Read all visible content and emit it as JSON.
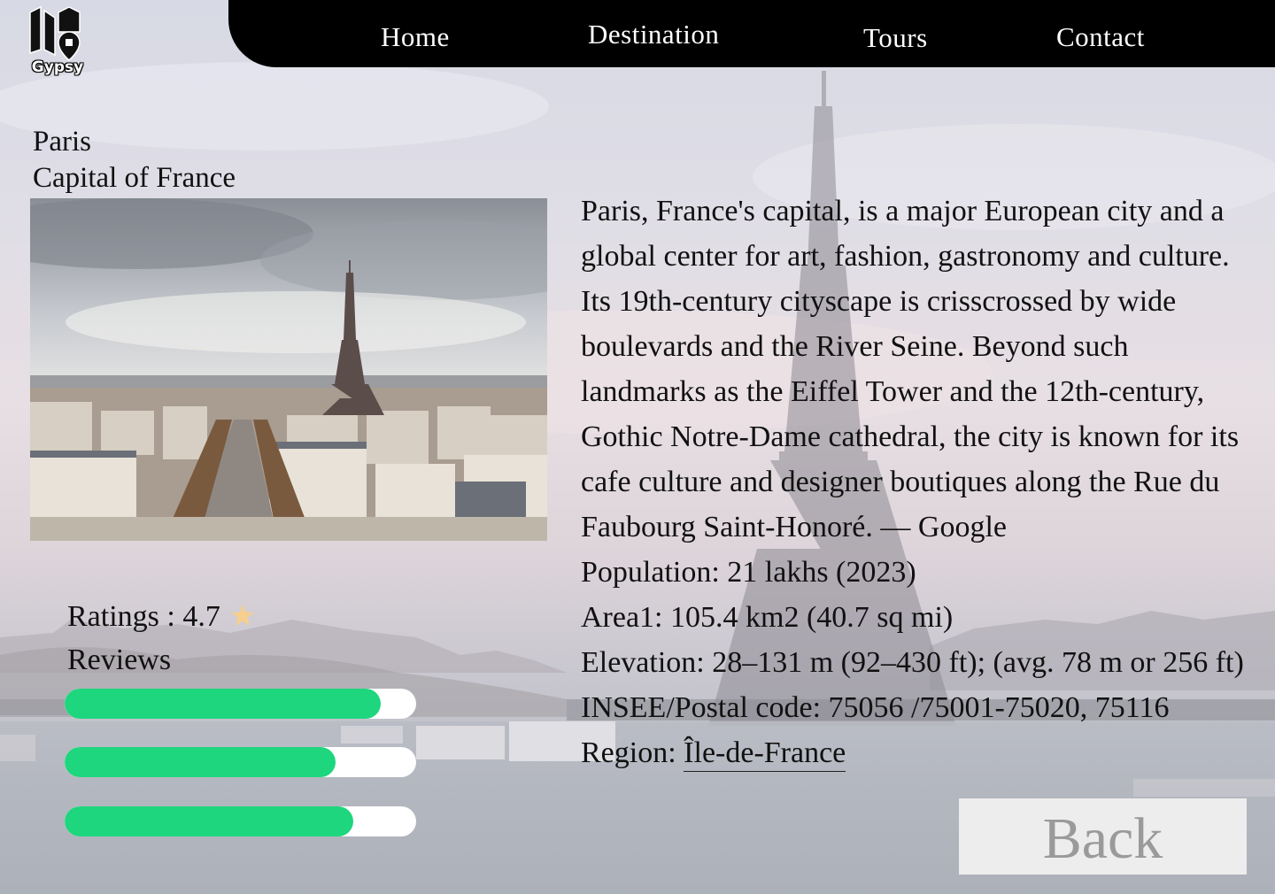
{
  "brand": {
    "name": "Gypsy",
    "logo_icon": "map-pin-building-icon"
  },
  "nav": {
    "home": "Home",
    "destination": "Destination",
    "tours": "Tours",
    "contact": "Contact"
  },
  "city": {
    "name": "Paris",
    "subtitle": "Capital of France"
  },
  "ratings": {
    "label": "Ratings : 4.7",
    "star": "★",
    "star_color": "#f7cf8c"
  },
  "reviews": {
    "label": "Reviews",
    "bars": [
      {
        "fill": 0.9
      },
      {
        "fill": 0.77
      },
      {
        "fill": 0.82
      }
    ],
    "fill_color": "#1ed67d"
  },
  "description": "Paris, France's capital, is a major European city and a global center for art, fashion, gastronomy and culture. Its 19th-century cityscape is crisscrossed by wide boulevards and the River Seine. Beyond such landmarks as the Eiffel Tower and the 12th-century, Gothic Notre-Dame cathedral, the city is known for its cafe culture and designer boutiques along the Rue du Faubourg Saint-Honoré. — Google",
  "facts": {
    "population": "Population: 21 lakhs (2023)",
    "area": "Area1: 105.4 km2 (40.7 sq mi)",
    "elevation": "Elevation: 28–131 m (92–430 ft); (avg. 78 m or 256 ft)",
    "postal": "INSEE/Postal code: 75056 /75001-75020, 75116",
    "region_label": "Region: ",
    "region_link": "Île-de-France"
  },
  "back_button": "Back"
}
